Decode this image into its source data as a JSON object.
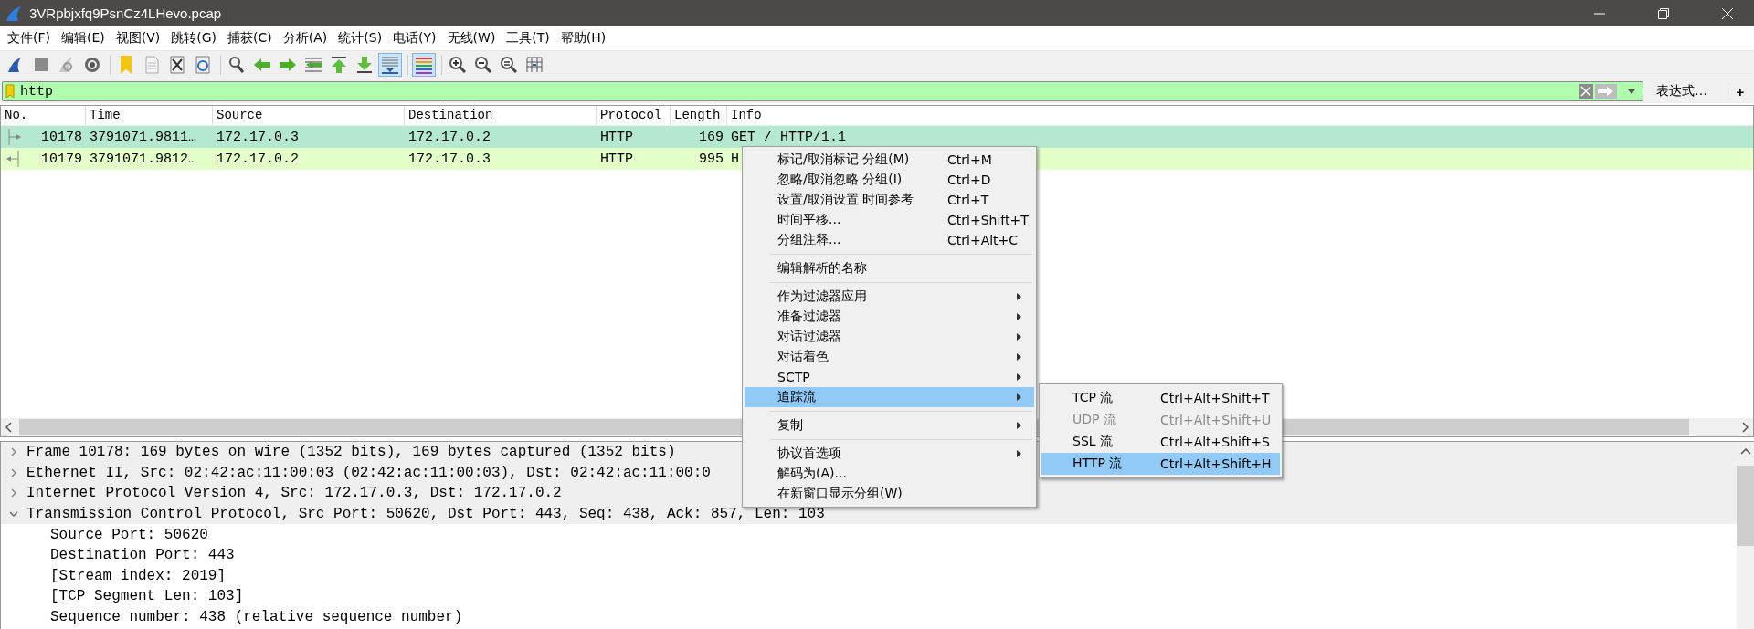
{
  "window": {
    "title": "3VRpbjxfq9PsnCz4LHevo.pcap"
  },
  "menu_bar": [
    "文件(F)",
    "编辑(E)",
    "视图(V)",
    "跳转(G)",
    "捕获(C)",
    "分析(A)",
    "统计(S)",
    "电话(Y)",
    "无线(W)",
    "工具(T)",
    "帮助(H)"
  ],
  "toolbar": [
    {
      "selected": false
    },
    {
      "selected": false
    },
    {
      "selected": false
    },
    {
      "selected": false
    },
    {
      "selected": false
    },
    {
      "selected": false
    },
    {
      "selected": false
    },
    {
      "selected": false
    },
    {
      "selected": false
    },
    {
      "selected": false
    },
    {
      "selected": false
    },
    {
      "selected": false
    },
    {
      "selected": false
    },
    {
      "selected": false
    },
    {
      "selected": true
    },
    {
      "selected": true
    },
    {
      "selected": false
    },
    {
      "selected": false
    },
    {
      "selected": false
    },
    {
      "selected": false
    }
  ],
  "filter": {
    "value": "http",
    "expression_button": "表达式…",
    "add_button": "+"
  },
  "packet_list": {
    "columns": [
      "No.",
      "Time",
      "Source",
      "Destination",
      "Protocol",
      "Length",
      "Info"
    ],
    "rows": [
      {
        "kind": "request",
        "color": "#b5e8d0",
        "no": "10178",
        "time": "3791071.9811…",
        "source": "172.17.0.3",
        "destination": "172.17.0.2",
        "protocol": "HTTP",
        "length": "169",
        "info": "GET / HTTP/1.1"
      },
      {
        "kind": "response",
        "color": "#e4ffc7",
        "no": "10179",
        "time": "3791071.9812…",
        "source": "172.17.0.2",
        "destination": "172.17.0.3",
        "protocol": "HTTP",
        "length": "995",
        "info": "H"
      }
    ]
  },
  "packet_details": [
    {
      "text": "Frame 10178: 169 bytes on wire (1352 bits), 169 bytes captured (1352 bits)",
      "expanded": false
    },
    {
      "text": "Ethernet II, Src: 02:42:ac:11:00:03 (02:42:ac:11:00:03), Dst: 02:42:ac:11:00:0",
      "expanded": false
    },
    {
      "text": "Internet Protocol Version 4, Src: 172.17.0.3, Dst: 172.17.0.2",
      "expanded": false
    },
    {
      "text": "Transmission Control Protocol, Src Port: 50620, Dst Port: 443, Seq: 438, Ack: 857, Len: 103",
      "expanded": true,
      "children": [
        {
          "text": "Source Port: 50620"
        },
        {
          "text": "Destination Port: 443"
        },
        {
          "text": "[Stream index: 2019]"
        },
        {
          "text": "[TCP Segment Len: 103]"
        },
        {
          "text": "Sequence number: 438    (relative sequence number)"
        }
      ]
    }
  ],
  "context_menu": [
    {
      "kind": "item",
      "label": "标记/取消标记 分组(M)",
      "shortcut": "Ctrl+M",
      "submenu": false,
      "selected": false
    },
    {
      "kind": "item",
      "label": "忽略/取消忽略 分组(I)",
      "shortcut": "Ctrl+D",
      "submenu": false,
      "selected": false
    },
    {
      "kind": "item",
      "label": "设置/取消设置 时间参考",
      "shortcut": "Ctrl+T",
      "submenu": false,
      "selected": false
    },
    {
      "kind": "item",
      "label": "时间平移...",
      "shortcut": "Ctrl+Shift+T",
      "submenu": false,
      "selected": false
    },
    {
      "kind": "item",
      "label": "分组注释...",
      "shortcut": "Ctrl+Alt+C",
      "submenu": false,
      "selected": false
    },
    {
      "kind": "separator"
    },
    {
      "kind": "item",
      "label": "编辑解析的名称",
      "submenu": false,
      "selected": false
    },
    {
      "kind": "separator"
    },
    {
      "kind": "item",
      "label": "作为过滤器应用",
      "submenu": true,
      "selected": false
    },
    {
      "kind": "item",
      "label": "准备过滤器",
      "submenu": true,
      "selected": false
    },
    {
      "kind": "item",
      "label": "对话过滤器",
      "submenu": true,
      "selected": false
    },
    {
      "kind": "item",
      "label": "对话着色",
      "submenu": true,
      "selected": false
    },
    {
      "kind": "item",
      "label": "SCTP",
      "submenu": true,
      "selected": false
    },
    {
      "kind": "item",
      "label": "追踪流",
      "submenu": true,
      "selected": true
    },
    {
      "kind": "separator"
    },
    {
      "kind": "item",
      "label": "复制",
      "submenu": true,
      "selected": false
    },
    {
      "kind": "separator"
    },
    {
      "kind": "item",
      "label": "协议首选项",
      "submenu": true,
      "selected": false
    },
    {
      "kind": "item",
      "label": "解码为(A)...",
      "submenu": false,
      "selected": false
    },
    {
      "kind": "item",
      "label": "在新窗口显示分组(W)",
      "submenu": false,
      "selected": false
    }
  ],
  "submenu": [
    {
      "label": "TCP 流",
      "shortcut": "Ctrl+Alt+Shift+T",
      "disabled": false,
      "selected": false
    },
    {
      "label": "UDP 流",
      "shortcut": "Ctrl+Alt+Shift+U",
      "disabled": true,
      "selected": false
    },
    {
      "label": "SSL 流",
      "shortcut": "Ctrl+Alt+Shift+S",
      "disabled": false,
      "selected": false
    },
    {
      "label": "HTTP 流",
      "shortcut": "Ctrl+Alt+Shift+H",
      "disabled": false,
      "selected": true
    }
  ]
}
